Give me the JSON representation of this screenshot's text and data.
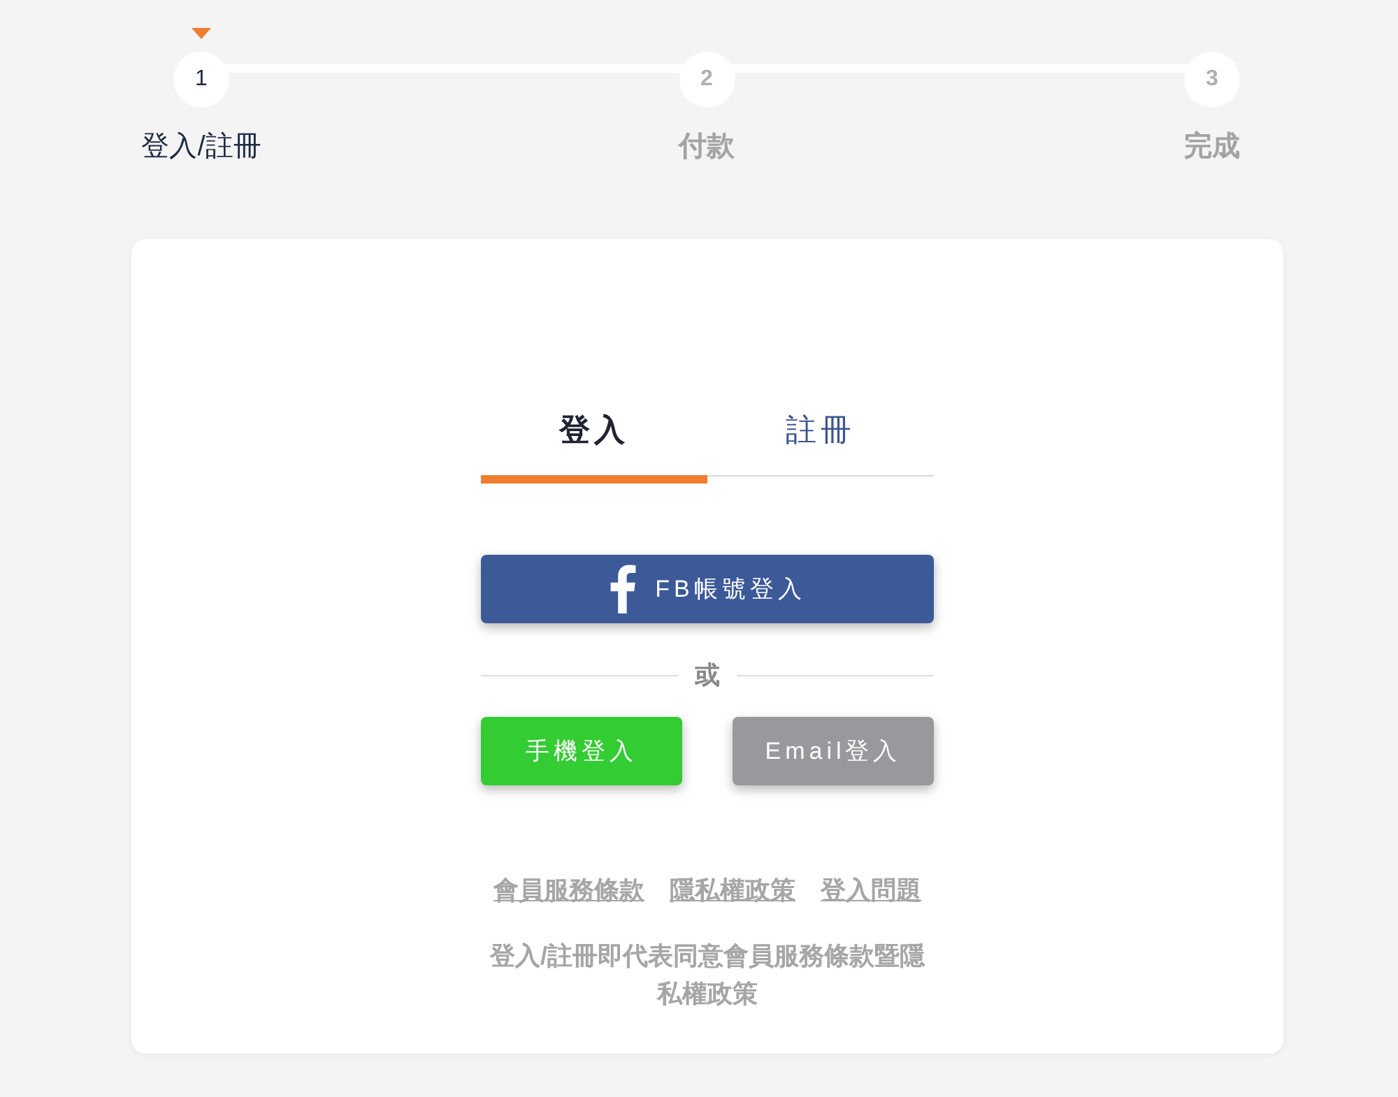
{
  "stepper": {
    "steps": [
      {
        "number": "1",
        "label": "登入/註冊",
        "selected": true
      },
      {
        "number": "2",
        "label": "付款",
        "selected": false
      },
      {
        "number": "3",
        "label": "完成",
        "selected": false
      }
    ]
  },
  "auth_card": {
    "tabs": [
      {
        "label": "登入",
        "selected": true
      },
      {
        "label": "註冊",
        "selected": false
      }
    ],
    "facebook_button": {
      "label": "FB帳號登入"
    },
    "divider": {
      "label": "或"
    },
    "login_buttons": [
      {
        "kind": "phone",
        "label": "手機登入"
      },
      {
        "kind": "email",
        "label": "Email登入"
      }
    ],
    "links": [
      "會員服務條款",
      "隱私權政策",
      "登入問題"
    ],
    "note": "登入/註冊即代表同意會員服務條款暨隱私權政策"
  }
}
